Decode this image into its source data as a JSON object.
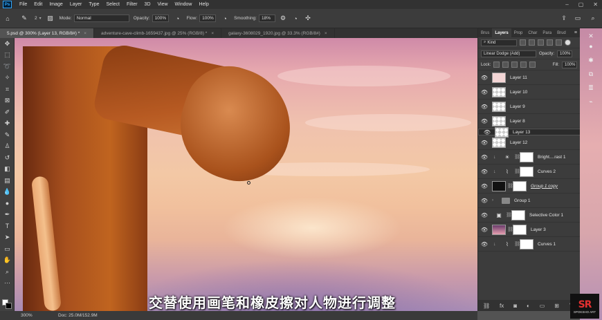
{
  "menubar": {
    "logo": "Ps",
    "items": [
      "File",
      "Edit",
      "Image",
      "Layer",
      "Type",
      "Select",
      "Filter",
      "3D",
      "View",
      "Window",
      "Help"
    ]
  },
  "options": {
    "brush_size": "2",
    "mode_label": "Mode:",
    "mode_value": "Normal",
    "opacity_label": "Opacity:",
    "opacity_value": "100%",
    "flow_label": "Flow:",
    "flow_value": "100%",
    "smoothing_label": "Smoothing:",
    "smoothing_value": "18%"
  },
  "tabs": [
    {
      "label": "5.psd @ 300% (Layer 13, RGB/8#) *"
    },
    {
      "label": "adventure-cave-climb-1659437.jpg @ 25% (RGB/8) *"
    },
    {
      "label": "galaxy-3608029_1920.jpg @ 33.3% (RGB/8#)"
    }
  ],
  "statusbar": {
    "zoom": "300%",
    "doc": "Doc: 25.0M/152.9M"
  },
  "subtitle": "交替使用画笔和橡皮擦对人物进行调整",
  "panel": {
    "tabs": [
      "Brus",
      "Layers",
      "Prop",
      "Char",
      "Para",
      "Brud"
    ],
    "filter_kind": "Kind",
    "blend_mode": "Linear Dodge (Add)",
    "opacity_label": "Opacity:",
    "opacity_value": "100%",
    "lock_label": "Lock:",
    "fill_label": "Fill:",
    "fill_value": "100%",
    "layers": [
      {
        "name": "Layer 11"
      },
      {
        "name": "Layer 10"
      },
      {
        "name": "Layer 9"
      },
      {
        "name": "Layer 8"
      },
      {
        "name": "Layer 13"
      },
      {
        "name": "Layer 12"
      },
      {
        "name": "Bright....rast 1"
      },
      {
        "name": "Curves 2"
      },
      {
        "name": "Group 1 copy"
      },
      {
        "name": "Group 1"
      },
      {
        "name": "Selective Color 1"
      },
      {
        "name": "Layer 3"
      },
      {
        "name": "Curves 1"
      }
    ]
  },
  "watermark": {
    "mark": "SR",
    "text": "SPOKSHO ART"
  },
  "icons": {
    "eye": "eye-icon",
    "brush": "brush-icon",
    "home": "home-icon"
  }
}
